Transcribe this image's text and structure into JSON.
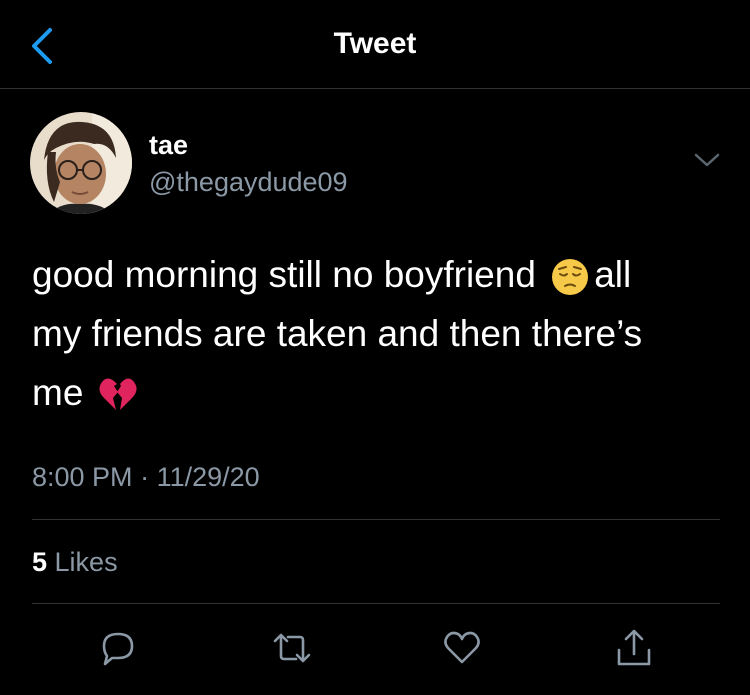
{
  "header": {
    "title": "Tweet",
    "back_icon": "chevron-left-icon",
    "accent": "#1d9bf0"
  },
  "tweet": {
    "display_name": "tae",
    "handle": "@thegaydude09",
    "text_line1": "good morning still no boyfriend",
    "text_line1b": "all",
    "text_line2": "my friends are taken and then there’s",
    "text_line3": "me",
    "emoji_1": "pensive-face-emoji",
    "emoji_2": "broken-heart-emoji",
    "time": "8:00 PM",
    "separator": " · ",
    "date": "11/29/20",
    "likes_count": "5",
    "likes_label": " Likes"
  },
  "actions": [
    "reply-icon",
    "retweet-icon",
    "like-icon",
    "share-icon"
  ],
  "colors": {
    "background": "#000000",
    "secondary_text": "#8b98a5",
    "divider": "#2f3336"
  }
}
